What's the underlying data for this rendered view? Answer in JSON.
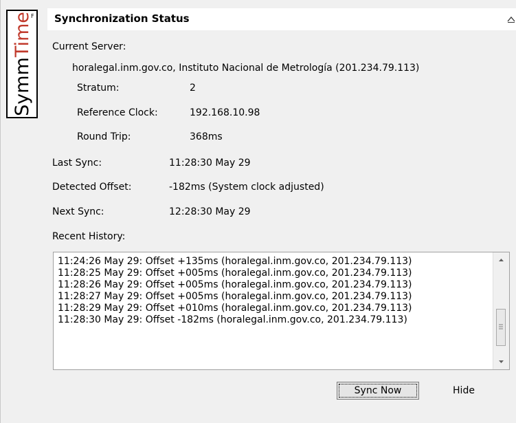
{
  "logo": {
    "text": "SymmTime",
    "mark": "F"
  },
  "header": {
    "title": "Synchronization Status"
  },
  "server": {
    "label": "Current Server:",
    "value": "horalegal.inm.gov.co, Instituto Nacional de Metrología (201.234.79.113)",
    "stratum_label": "Stratum:",
    "stratum_value": "2",
    "ref_clock_label": "Reference Clock:",
    "ref_clock_value": "192.168.10.98",
    "round_trip_label": "Round Trip:",
    "round_trip_value": "368ms"
  },
  "sync": {
    "last_label": "Last Sync:",
    "last_value": "11:28:30 May 29",
    "offset_label": "Detected Offset:",
    "offset_value": "-182ms (System clock adjusted)",
    "next_label": "Next Sync:",
    "next_value": "12:28:30 May 29"
  },
  "history": {
    "label": "Recent History:",
    "lines": [
      "11:24:26 May 29: Offset +135ms  (horalegal.inm.gov.co, 201.234.79.113)",
      "11:28:25 May 29: Offset +005ms  (horalegal.inm.gov.co, 201.234.79.113)",
      "11:28:26 May 29: Offset +005ms  (horalegal.inm.gov.co, 201.234.79.113)",
      "11:28:27 May 29: Offset +005ms  (horalegal.inm.gov.co, 201.234.79.113)",
      "11:28:29 May 29: Offset +010ms  (horalegal.inm.gov.co, 201.234.79.113)",
      "11:28:30 May 29: Offset -182ms  (horalegal.inm.gov.co, 201.234.79.113)"
    ]
  },
  "buttons": {
    "sync_now": "Sync Now",
    "hide": "Hide"
  },
  "icons": {
    "collapse": "chevron-up-icon",
    "scroll_up": "scroll-up-arrow-icon",
    "scroll_down": "scroll-down-arrow-icon"
  }
}
